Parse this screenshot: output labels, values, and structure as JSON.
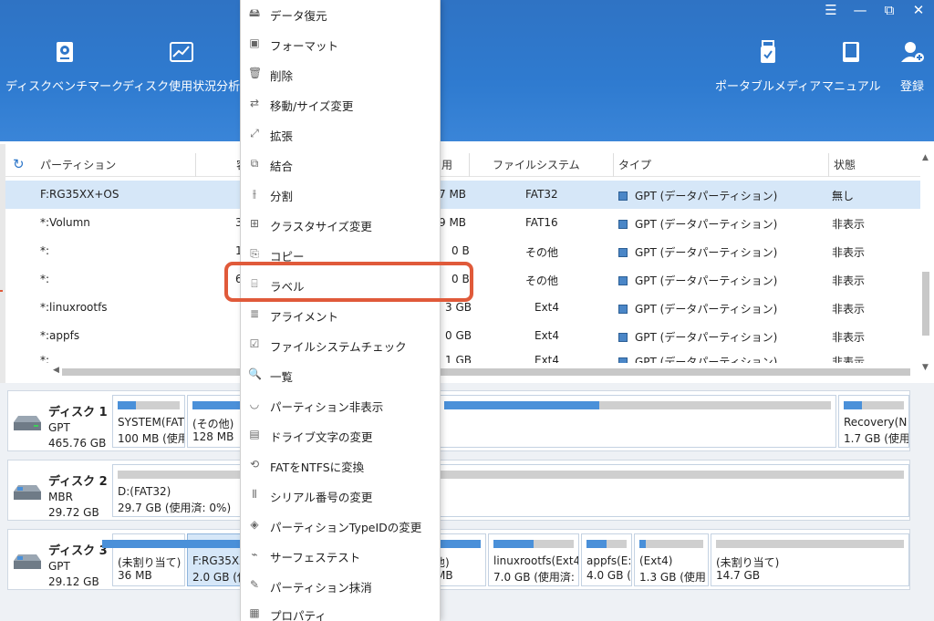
{
  "window_controls": [
    "☰",
    "—",
    "⧉",
    "✕"
  ],
  "toolbar": {
    "left": [
      {
        "label": "ディスクベンチマーク",
        "icon": "disk-benchmark-icon"
      },
      {
        "label": "ディスク使用状況分析",
        "icon": "disk-usage-analysis-icon"
      }
    ],
    "right": [
      {
        "label": "ポータブルメディア",
        "icon": "portable-media-icon"
      },
      {
        "label": "マニュアル",
        "icon": "manual-book-icon"
      },
      {
        "label": "登録",
        "icon": "register-user-icon"
      }
    ]
  },
  "table": {
    "headers": {
      "partition": "パーティション",
      "col2_fragment": "容",
      "col3_fragment": "用",
      "filesystem": "ファイルシステム",
      "type": "タイプ",
      "status": "状態"
    },
    "rows": [
      {
        "name": "F:RG35XX+OS",
        "cap": "",
        "used": "7 MB",
        "fs": "FAT32",
        "type": "GPT (データパーティション)",
        "status": "無し",
        "selected": true
      },
      {
        "name": "*:Volumn",
        "cap": "3.",
        "used": "9 MB",
        "fs": "FAT16",
        "type": "GPT (データパーティション)",
        "status": "非表示"
      },
      {
        "name": "*:",
        "cap": "1(",
        "used": "0 B",
        "fs": "その他",
        "type": "GPT (データパーティション)",
        "status": "非表示"
      },
      {
        "name": "*:",
        "cap": "64",
        "used": "0 B",
        "fs": "その他",
        "type": "GPT (データパーティション)",
        "status": "非表示"
      },
      {
        "name": "*:linuxrootfs",
        "cap": "",
        "used": "3 GB",
        "fs": "Ext4",
        "type": "GPT (データパーティション)",
        "status": "非表示"
      },
      {
        "name": "*:appfs",
        "cap": "",
        "used": "0 GB",
        "fs": "Ext4",
        "type": "GPT (データパーティション)",
        "status": "非表示"
      },
      {
        "name": "*:",
        "cap": "",
        "used": "1 GB",
        "fs": "Ext4",
        "type": "GPT (データパーティション)",
        "status": "非表示"
      }
    ]
  },
  "disks": [
    {
      "name": "ディスク 1",
      "type": "GPT",
      "size": "465.76 GB",
      "partitions": [
        {
          "label": "SYSTEM(FAT",
          "size": "100 MB (使用",
          "fill": 0.3
        },
        {
          "label": "(その他)",
          "size": "128 MB",
          "fill": 1.0
        },
        {
          "label": "",
          "size": "",
          "fill": 0.4
        },
        {
          "label": "Recovery(N",
          "size": "1.7 GB (使用",
          "fill": 0.3
        }
      ]
    },
    {
      "name": "ディスク 2",
      "type": "MBR",
      "size": "29.72 GB",
      "partitions": [
        {
          "label": "D:(FAT32)",
          "size": "29.7 GB (使用済: 0%)",
          "fill": 0.0
        }
      ]
    },
    {
      "name": "ディスク 3",
      "type": "GPT",
      "size": "29.12 GB",
      "partitions": [
        {
          "label": "(未割り当て)",
          "size": "36 MB",
          "fill": 0.0
        },
        {
          "label": "F:RG35XX",
          "size": "2.0 GB (使",
          "fill": 1.0
        },
        {
          "label": "他)",
          "size": "MB",
          "fill": 1.0
        },
        {
          "label": "linuxrootfs(Ext4",
          "size": "7.0 GB (使用済:",
          "fill": 0.5
        },
        {
          "label": "appfs(E:",
          "size": "4.0 GB (",
          "fill": 0.5
        },
        {
          "label": "(Ext4)",
          "size": "1.3 GB (使用",
          "fill": 0.1
        },
        {
          "label": "(未割り当て)",
          "size": "14.7 GB",
          "fill": 0.0
        }
      ]
    }
  ],
  "context_menu": [
    {
      "label": "データ復元",
      "icon": "data-recovery-icon"
    },
    {
      "label": "フォーマット",
      "icon": "format-icon"
    },
    {
      "label": "削除",
      "icon": "delete-icon"
    },
    {
      "label": "移動/サイズ変更",
      "icon": "resize-icon"
    },
    {
      "label": "拡張",
      "icon": "extend-icon"
    },
    {
      "label": "結合",
      "icon": "merge-icon"
    },
    {
      "label": "分割",
      "icon": "split-icon"
    },
    {
      "label": "クラスタサイズ変更",
      "icon": "cluster-size-icon"
    },
    {
      "label": "コピー",
      "icon": "copy-icon"
    },
    {
      "label": "ラベル",
      "icon": "label-icon",
      "highlighted": true
    },
    {
      "label": "アライメント",
      "icon": "alignment-icon"
    },
    {
      "label": "ファイルシステムチェック",
      "icon": "filesystem-check-icon"
    },
    {
      "label": "一覧",
      "icon": "search-icon"
    },
    {
      "label": "パーティション非表示",
      "icon": "hide-eye-icon"
    },
    {
      "label": "ドライブ文字の変更",
      "icon": "drive-letter-icon"
    },
    {
      "label": "FATをNTFSに変換",
      "icon": "convert-icon"
    },
    {
      "label": "シリアル番号の変更",
      "icon": "serial-number-icon"
    },
    {
      "label": "パーティションTypeIDの変更",
      "icon": "typeid-icon"
    },
    {
      "label": "サーフェステスト",
      "icon": "surface-test-icon"
    },
    {
      "label": "パーティション抹消",
      "icon": "wipe-icon"
    },
    {
      "label": "プロパティ",
      "icon": "properties-icon"
    }
  ],
  "colors": {
    "header_blue": "#2f77c9",
    "selection": "#d6e7f8",
    "bar_fill": "#4a90d9",
    "highlight_ring": "#e05a3a"
  }
}
